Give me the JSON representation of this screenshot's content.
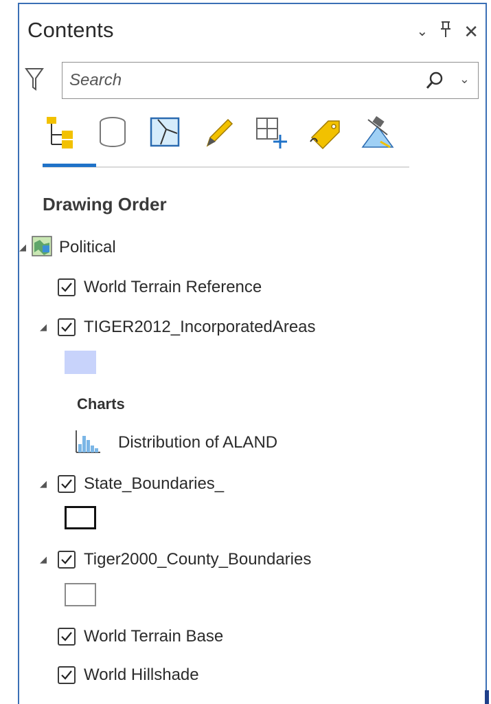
{
  "panel": {
    "title": "Contents",
    "actions": {
      "options_icon": "chevron-down-icon",
      "pin_icon": "pin-icon",
      "close_icon": "close-icon"
    }
  },
  "search": {
    "placeholder": "Search",
    "value": ""
  },
  "toolbar": {
    "active_tab": "drawing-order",
    "tools": [
      "list-by-drawing-order-icon",
      "list-by-data-source-icon",
      "list-by-selection-icon",
      "list-by-editing-icon",
      "list-by-snapping-icon",
      "list-by-labeling-icon",
      "list-by-perspective-imagery-icon"
    ]
  },
  "view_heading": "Drawing Order",
  "tree": {
    "map": {
      "label": "Political",
      "expanded": true
    },
    "layers": [
      {
        "label": "World Terrain Reference",
        "checked": true,
        "expanded": false
      },
      {
        "label": "TIGER2012_IncorporatedAreas",
        "checked": true,
        "expanded": true,
        "symbol": "fill",
        "symbol_color": "#c8d3fb"
      },
      {
        "charts_heading": "Charts",
        "chart_label": "Distribution of ALAND"
      },
      {
        "label": "State_Boundaries_",
        "checked": true,
        "expanded": true,
        "symbol": "outline-black"
      },
      {
        "label": "Tiger2000_County_Boundaries",
        "checked": true,
        "expanded": true,
        "symbol": "outline-gray"
      },
      {
        "label": "World Terrain Base",
        "checked": true,
        "expanded": false
      },
      {
        "label": "World Hillshade",
        "checked": true,
        "expanded": false
      }
    ]
  },
  "colors": {
    "panel_border": "#3a6fb5",
    "active_tab": "#1f72c8",
    "accent_yellow": "#f2c100",
    "fill_symbol": "#c8d3fb"
  }
}
